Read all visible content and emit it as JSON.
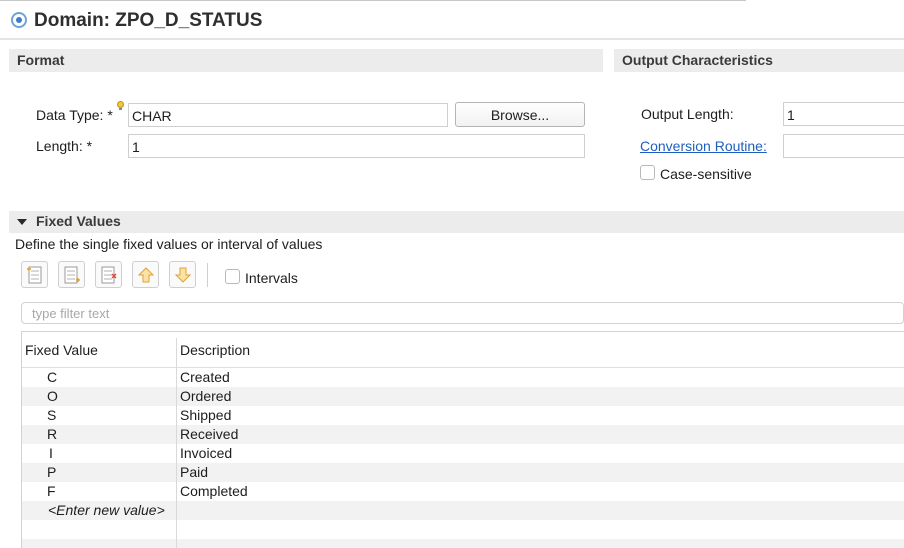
{
  "domain": {
    "title": "Domain: ZPO_D_STATUS"
  },
  "format": {
    "header": "Format",
    "data_type_label": "Data Type: *",
    "data_type_value": "CHAR",
    "browse_label": "Browse...",
    "length_label": "Length: *",
    "length_value": "1"
  },
  "output": {
    "header": "Output Characteristics",
    "output_length_label": "Output Length:",
    "output_length_value": "1",
    "conversion_routine_label": "Conversion Routine:",
    "conversion_routine_value": "",
    "case_sensitive_label": "Case-sensitive",
    "case_sensitive_checked": false
  },
  "fixed_values": {
    "header": "Fixed Values",
    "description": "Define the single fixed values or interval of values",
    "toolbar": {
      "icons": [
        "add-value-icon",
        "insert-value-icon",
        "delete-value-icon",
        "move-up-icon",
        "move-down-icon"
      ],
      "intervals_label": "Intervals",
      "intervals_checked": false
    },
    "filter_placeholder": "type filter text",
    "columns": [
      "Fixed Value",
      "Description"
    ],
    "rows": [
      {
        "value": "C",
        "description": "Created"
      },
      {
        "value": "O",
        "description": "Ordered"
      },
      {
        "value": "S",
        "description": "Shipped"
      },
      {
        "value": "R",
        "description": "Received"
      },
      {
        "value": "I",
        "description": "Invoiced"
      },
      {
        "value": "P",
        "description": "Paid"
      },
      {
        "value": "F",
        "description": "Completed"
      }
    ],
    "new_value_placeholder": "<Enter new value>"
  },
  "colors": {
    "link": "#1f5fbf",
    "section_bg": "#ececec",
    "arrow": "#f0c04a"
  }
}
